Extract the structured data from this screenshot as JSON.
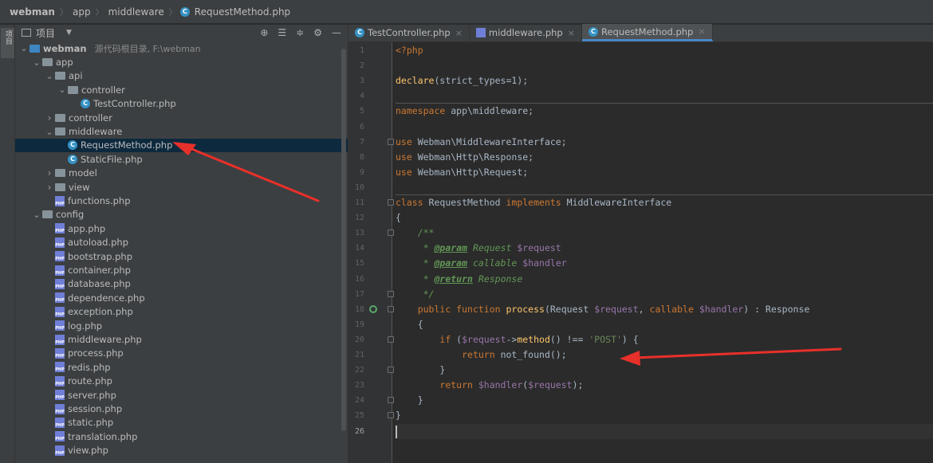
{
  "breadcrumb": {
    "items": [
      "webman",
      "app",
      "middleware",
      "RequestMethod.php"
    ]
  },
  "side_strip": {
    "label": "项目"
  },
  "project_panel": {
    "title": "项目",
    "tree": [
      {
        "label": "webman",
        "note": "源代码根目录,  F:\\webman",
        "type": "root-folder",
        "expanded": true,
        "depth": 0,
        "bold": true
      },
      {
        "label": "app",
        "type": "folder",
        "expanded": true,
        "depth": 1
      },
      {
        "label": "api",
        "type": "folder",
        "expanded": true,
        "depth": 2
      },
      {
        "label": "controller",
        "type": "folder",
        "expanded": true,
        "depth": 3
      },
      {
        "label": "TestController.php",
        "type": "class",
        "depth": 4
      },
      {
        "label": "controller",
        "type": "folder",
        "expanded": false,
        "depth": 2
      },
      {
        "label": "middleware",
        "type": "folder",
        "expanded": true,
        "depth": 2
      },
      {
        "label": "RequestMethod.php",
        "type": "class",
        "depth": 3,
        "selected": true
      },
      {
        "label": "StaticFile.php",
        "type": "class",
        "depth": 3
      },
      {
        "label": "model",
        "type": "folder",
        "expanded": false,
        "depth": 2
      },
      {
        "label": "view",
        "type": "folder",
        "expanded": false,
        "depth": 2
      },
      {
        "label": "functions.php",
        "type": "php",
        "depth": 2
      },
      {
        "label": "config",
        "type": "folder",
        "expanded": true,
        "depth": 1
      },
      {
        "label": "app.php",
        "type": "php",
        "depth": 2
      },
      {
        "label": "autoload.php",
        "type": "php",
        "depth": 2
      },
      {
        "label": "bootstrap.php",
        "type": "php",
        "depth": 2
      },
      {
        "label": "container.php",
        "type": "php",
        "depth": 2
      },
      {
        "label": "database.php",
        "type": "php",
        "depth": 2
      },
      {
        "label": "dependence.php",
        "type": "php",
        "depth": 2
      },
      {
        "label": "exception.php",
        "type": "php",
        "depth": 2
      },
      {
        "label": "log.php",
        "type": "php",
        "depth": 2
      },
      {
        "label": "middleware.php",
        "type": "php",
        "depth": 2
      },
      {
        "label": "process.php",
        "type": "php",
        "depth": 2
      },
      {
        "label": "redis.php",
        "type": "php",
        "depth": 2
      },
      {
        "label": "route.php",
        "type": "php",
        "depth": 2
      },
      {
        "label": "server.php",
        "type": "php",
        "depth": 2
      },
      {
        "label": "session.php",
        "type": "php",
        "depth": 2
      },
      {
        "label": "static.php",
        "type": "php",
        "depth": 2
      },
      {
        "label": "translation.php",
        "type": "php",
        "depth": 2
      },
      {
        "label": "view.php",
        "type": "php",
        "depth": 2
      }
    ]
  },
  "editor": {
    "tabs": [
      {
        "label": "TestController.php",
        "icon": "class-icon",
        "active": false
      },
      {
        "label": "middleware.php",
        "icon": "php-file-icon",
        "active": false
      },
      {
        "label": "RequestMethod.php",
        "icon": "class-icon",
        "active": true
      }
    ],
    "current_line": 26,
    "lines": [
      [
        [
          "ph",
          "<?php"
        ]
      ],
      [],
      [
        [
          "fn",
          "declare"
        ],
        [
          "plain",
          "(strict_types=1);"
        ]
      ],
      [],
      [
        [
          "kw",
          "namespace "
        ],
        [
          "plain",
          "app\\middleware;"
        ]
      ],
      [],
      [
        [
          "kw",
          "use "
        ],
        [
          "plain",
          "Webman\\MiddlewareInterface;"
        ]
      ],
      [
        [
          "kw",
          "use "
        ],
        [
          "plain",
          "Webman\\Http\\Response;"
        ]
      ],
      [
        [
          "kw",
          "use "
        ],
        [
          "plain",
          "Webman\\Http\\Request;"
        ]
      ],
      [],
      [
        [
          "kw",
          "class "
        ],
        [
          "plain",
          "RequestMethod "
        ],
        [
          "kw",
          "implements "
        ],
        [
          "plain",
          "MiddlewareInterface"
        ]
      ],
      [
        [
          "plain",
          "{"
        ]
      ],
      [
        [
          "plain",
          "    "
        ],
        [
          "cm",
          "/**"
        ]
      ],
      [
        [
          "plain",
          "     "
        ],
        [
          "cm",
          "* "
        ],
        [
          "tag",
          "@param"
        ],
        [
          "cm",
          " Request "
        ],
        [
          "var",
          "$request"
        ]
      ],
      [
        [
          "plain",
          "     "
        ],
        [
          "cm",
          "* "
        ],
        [
          "tag",
          "@param"
        ],
        [
          "cm",
          " callable "
        ],
        [
          "var",
          "$handler"
        ]
      ],
      [
        [
          "plain",
          "     "
        ],
        [
          "cm",
          "* "
        ],
        [
          "tag",
          "@return"
        ],
        [
          "cm",
          " Response"
        ]
      ],
      [
        [
          "plain",
          "     "
        ],
        [
          "cm",
          "*/"
        ]
      ],
      [
        [
          "plain",
          "    "
        ],
        [
          "kw",
          "public function "
        ],
        [
          "fn",
          "process"
        ],
        [
          "plain",
          "(Request "
        ],
        [
          "var",
          "$request"
        ],
        [
          "plain",
          ", "
        ],
        [
          "kw",
          "callable "
        ],
        [
          "var",
          "$handler"
        ],
        [
          "plain",
          ") : Response"
        ]
      ],
      [
        [
          "plain",
          "    {"
        ]
      ],
      [
        [
          "plain",
          "        "
        ],
        [
          "kw",
          "if "
        ],
        [
          "plain",
          "("
        ],
        [
          "var",
          "$request"
        ],
        [
          "plain",
          "->"
        ],
        [
          "fn",
          "method"
        ],
        [
          "plain",
          "() !== "
        ],
        [
          "str",
          "'POST'"
        ],
        [
          "plain",
          ") {"
        ]
      ],
      [
        [
          "plain",
          "            "
        ],
        [
          "kw",
          "return "
        ],
        [
          "plain",
          "not_found();"
        ]
      ],
      [
        [
          "plain",
          "        }"
        ]
      ],
      [
        [
          "plain",
          "        "
        ],
        [
          "kw",
          "return "
        ],
        [
          "var",
          "$handler"
        ],
        [
          "plain",
          "("
        ],
        [
          "var",
          "$request"
        ],
        [
          "plain",
          ");"
        ]
      ],
      [
        [
          "plain",
          "    }"
        ]
      ],
      [
        [
          "plain",
          "}"
        ]
      ],
      []
    ]
  },
  "colors": {
    "accent": "#4a88c7",
    "annotation_arrow": "#e8302a",
    "selection": "#0d293e"
  }
}
